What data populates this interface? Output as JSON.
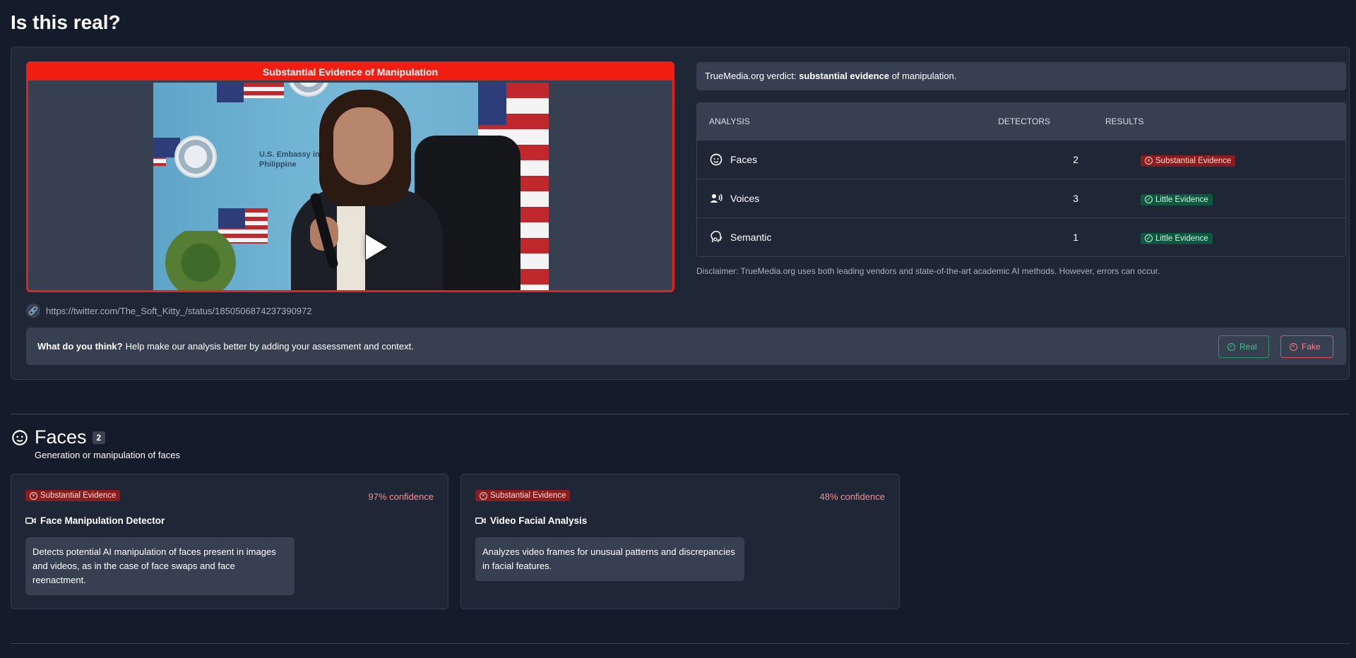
{
  "page": {
    "title": "Is this real?"
  },
  "video": {
    "banner": "Substantial Evidence of Manipulation",
    "play_icon": "play-icon",
    "url": "https://twitter.com/The_Soft_Kitty_/status/1850506874237390972"
  },
  "verdict": {
    "prefix": "TrueMedia.org verdict: ",
    "emphasis": "substantial evidence",
    "suffix": " of manipulation."
  },
  "analysis_table": {
    "headers": {
      "analysis": "ANALYSIS",
      "detectors": "DETECTORS",
      "results": "RESULTS"
    },
    "rows": [
      {
        "icon": "face-icon",
        "label": "Faces",
        "detectors": "2",
        "result": "Substantial Evidence",
        "result_type": "bad"
      },
      {
        "icon": "voice-icon",
        "label": "Voices",
        "detectors": "3",
        "result": "Little Evidence",
        "result_type": "good"
      },
      {
        "icon": "semantic-icon",
        "label": "Semantic",
        "detectors": "1",
        "result": "Little Evidence",
        "result_type": "good"
      }
    ]
  },
  "disclaimer": "Disclaimer: TrueMedia.org uses both leading vendors and state-of-the-art academic AI methods. However, errors can occur.",
  "feedback": {
    "question": "What do you think?",
    "prompt": "Help make our analysis better by adding your assessment and context.",
    "real_label": "Real",
    "fake_label": "Fake"
  },
  "faces_section": {
    "title": "Faces",
    "count": "2",
    "subtitle": "Generation or manipulation of faces",
    "detectors": [
      {
        "badge": "Substantial Evidence",
        "confidence": "97% confidence",
        "name": "Face Manipulation Detector",
        "description": "Detects potential AI manipulation of faces present in images and videos, as in the case of face swaps and face reenactment."
      },
      {
        "badge": "Substantial Evidence",
        "confidence": "48% confidence",
        "name": "Video Facial Analysis",
        "description": "Analyzes video frames for unusual patterns and discrepancies in facial features."
      }
    ]
  },
  "colors": {
    "background": "#141b2b",
    "card": "#1f2636",
    "banner_red": "#f01d10",
    "bad_badge": "#8b1c1e",
    "good_badge": "#10573f",
    "confidence_red": "#ff8a8a",
    "real_green": "#3dbf8d",
    "fake_red": "#ff7b86"
  }
}
